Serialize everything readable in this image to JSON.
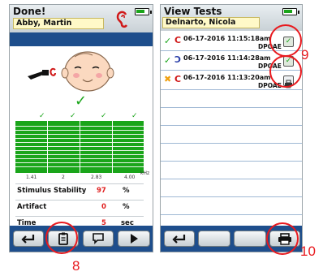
{
  "left_screen": {
    "title": "Done!",
    "patient": "Abby, Martin",
    "stats": [
      {
        "label": "Stimulus Stability",
        "value": "97",
        "unit": "%"
      },
      {
        "label": "Artifact",
        "value": "0",
        "unit": "%"
      },
      {
        "label": "Time",
        "value": "5",
        "unit": "sec"
      }
    ],
    "chart_ticks": [
      "1.41",
      "2",
      "2.83",
      "4.00"
    ],
    "chart_unit": "kHz"
  },
  "right_screen": {
    "title": "View Tests",
    "patient": "Delnarto, Nicola",
    "tests": [
      {
        "datetime": "06-17-2016 11:15:18am",
        "type": "DPOAE",
        "status": "pass"
      },
      {
        "datetime": "06-17-2016 11:14:28am",
        "type": "DPOAE",
        "status": "pass"
      },
      {
        "datetime": "06-17-2016 11:13:20am",
        "type": "DPOAE",
        "status": "fail"
      }
    ]
  },
  "callouts": [
    "8",
    "9",
    "10"
  ],
  "colors": {
    "accent_blue": "#1e4e8c",
    "pass_green": "#1aa51a",
    "highlight_red": "#e8191e"
  }
}
